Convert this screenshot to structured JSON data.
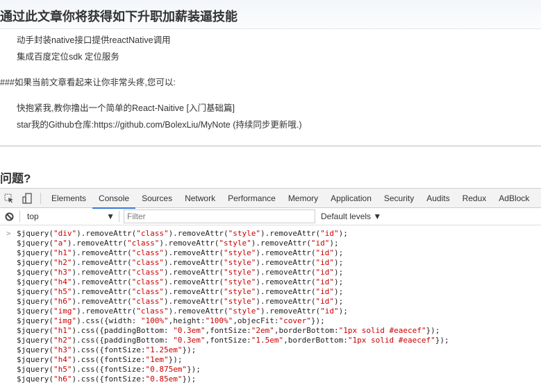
{
  "article": {
    "heading": "通过此文章你将获得如下升职加薪装逼技能",
    "items": [
      "动手封装native接口提供reactNative调用",
      "集成百度定位sdk 定位服务"
    ],
    "note": "###如果当前文章看起来让你非常头疼,您可以:",
    "links": [
      "快抱紧我,教你撸出一个简单的React-Naitive [入门基础篇]",
      "star我的Github仓库:https://github.com/BolexLiu/MyNote (持续同步更新哦.)"
    ],
    "heading2": "问题?"
  },
  "devtools": {
    "tabs": [
      "Elements",
      "Console",
      "Sources",
      "Network",
      "Performance",
      "Memory",
      "Application",
      "Security",
      "Audits",
      "Redux",
      "AdBlock"
    ],
    "active_tab": "Console",
    "context": "top",
    "filter_placeholder": "Filter",
    "levels": "Default levels ▼",
    "prompt": ">",
    "lines": [
      [
        "$jquery(",
        "\"div\"",
        ").removeAttr(",
        "\"class\"",
        ").removeAttr(",
        "\"style\"",
        ").removeAttr(",
        "\"id\"",
        ");"
      ],
      [
        "$jquery(",
        "\"a\"",
        ").removeAttr(",
        "\"class\"",
        ").removeAttr(",
        "\"style\"",
        ").removeAttr(",
        "\"id\"",
        ");"
      ],
      [
        "$jquery(",
        "\"h1\"",
        ").removeAttr(",
        "\"class\"",
        ").removeAttr(",
        "\"style\"",
        ").removeAttr(",
        "\"id\"",
        ");"
      ],
      [
        "$jquery(",
        "\"h2\"",
        ").removeAttr(",
        "\"class\"",
        ").removeAttr(",
        "\"style\"",
        ").removeAttr(",
        "\"id\"",
        ");"
      ],
      [
        "$jquery(",
        "\"h3\"",
        ").removeAttr(",
        "\"class\"",
        ").removeAttr(",
        "\"style\"",
        ").removeAttr(",
        "\"id\"",
        ");"
      ],
      [
        "$jquery(",
        "\"h4\"",
        ").removeAttr(",
        "\"class\"",
        ").removeAttr(",
        "\"style\"",
        ").removeAttr(",
        "\"id\"",
        ");"
      ],
      [
        "$jquery(",
        "\"h5\"",
        ").removeAttr(",
        "\"class\"",
        ").removeAttr(",
        "\"style\"",
        ").removeAttr(",
        "\"id\"",
        ");"
      ],
      [
        "$jquery(",
        "\"h6\"",
        ").removeAttr(",
        "\"class\"",
        ").removeAttr(",
        "\"style\"",
        ").removeAttr(",
        "\"id\"",
        ");"
      ],
      [
        "$jquery(",
        "\"img\"",
        ").removeAttr(",
        "\"class\"",
        ").removeAttr(",
        "\"style\"",
        ").removeAttr(",
        "\"id\"",
        ");"
      ],
      [
        "$jquery(",
        "\"img\"",
        ").css({width: ",
        "\"100%\"",
        ",height:",
        "\"100%\"",
        ",objecFit:",
        "\"cover\"",
        "});"
      ],
      [
        "$jquery(",
        "\"h1\"",
        ").css({paddingBottom: ",
        "\"0.3em\"",
        ",fontSize:",
        "\"2em\"",
        ",borderBottom:",
        "\"1px solid #eaecef\"",
        "});"
      ],
      [
        "$jquery(",
        "\"h2\"",
        ").css({paddingBottom: ",
        "\"0.3em\"",
        ",fontSize:",
        "\"1.5em\"",
        ",borderBottom:",
        "\"1px solid #eaecef\"",
        "});"
      ],
      [
        "$jquery(",
        "\"h3\"",
        ").css({fontSize:",
        "\"1.25em\"",
        "});"
      ],
      [
        "$jquery(",
        "\"h4\"",
        ").css({fontSize:",
        "\"1em\"",
        "});"
      ],
      [
        "$jquery(",
        "\"h5\"",
        ").css({fontSize:",
        "\"0.875em\"",
        "});"
      ],
      [
        "$jquery(",
        "\"h6\"",
        ").css({fontSize:",
        "\"0.85em\"",
        "});"
      ]
    ]
  }
}
